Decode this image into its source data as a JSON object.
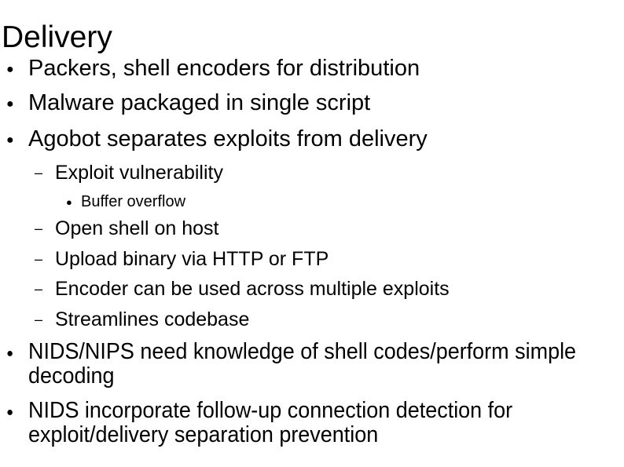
{
  "slide": {
    "title": "Delivery",
    "bullets": [
      {
        "level": 1,
        "text": "Packers, shell encoders for distribution"
      },
      {
        "level": 1,
        "text": "Malware packaged in single script"
      },
      {
        "level": 1,
        "text": "Agobot separates exploits from delivery"
      },
      {
        "level": 2,
        "text": "Exploit vulnerability"
      },
      {
        "level": 3,
        "text": "Buffer overflow"
      },
      {
        "level": 2,
        "text": "Open shell on host"
      },
      {
        "level": 2,
        "text": "Upload binary via HTTP or FTP"
      },
      {
        "level": 2,
        "text": "Encoder can be used across multiple exploits"
      },
      {
        "level": 2,
        "text": "Streamlines codebase"
      },
      {
        "level": 1,
        "text": "NIDS/NIPS need knowledge of shell codes/perform simple decoding"
      },
      {
        "level": 1,
        "text": "NIDS incorporate follow-up connection detection for exploit/delivery separation prevention"
      }
    ],
    "bullet_glyphs": {
      "level1": "●",
      "level2": "–",
      "level3": "●"
    }
  }
}
